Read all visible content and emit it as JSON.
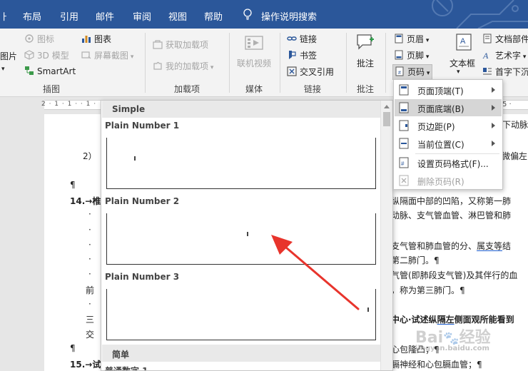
{
  "menubar": {
    "tabs": [
      "ㅏ",
      "布局",
      "引用",
      "邮件",
      "审阅",
      "视图",
      "帮助",
      "操作说明搜索"
    ]
  },
  "ribbon": {
    "illustrations": {
      "partial_left": "图片",
      "icons": "图标",
      "models_3d": "3D 模型",
      "smartart": "SmartArt",
      "chart": "图表",
      "screenshot": "屏幕截图",
      "group_label": "插图"
    },
    "addins": {
      "get_addins": "获取加载项",
      "my_addins": "我的加载项",
      "group_label": "加载项"
    },
    "media": {
      "online_video": "联机视频",
      "group_label": "媒体"
    },
    "links": {
      "link": "链接",
      "bookmark": "书签",
      "cross_ref": "交叉引用",
      "group_label": "链接"
    },
    "comments": {
      "comment": "批注",
      "group_label": "批注"
    },
    "header_footer": {
      "header": "页眉",
      "footer": "页脚",
      "page_number": "页码"
    },
    "text": {
      "textbox": "文本框",
      "quick_parts": "文档部件",
      "wordart": "艺术字",
      "dropcap": "首字下沉"
    }
  },
  "ruler": {
    "marks": "2 · 1 · 1 · · 1 ·",
    "right": "5 ·"
  },
  "gallery": {
    "section_simple": "Simple",
    "items": [
      "Plain Number 1",
      "Plain Number 2",
      "Plain Number 3"
    ],
    "section_cn": "简单",
    "cn_item": "普通数字 1"
  },
  "submenu": {
    "items": [
      "页面顶端(T)",
      "页面底端(B)",
      "页边距(P)",
      "当前位置(C)",
      "设置页码格式(F)...",
      "删除页码(R)"
    ]
  },
  "document": {
    "lines": [
      "下动脉",
      "2）",
      "微偏左",
      "¶",
      "14.→椎",
      "纵隔面中部的凹陷，又称第一肺",
      "·",
      "动脉、支气管血管、淋巴管和肺",
      "·",
      "·",
      "支气管和肺血管的分、",
      "属支等",
      "结",
      "·",
      "第二肺门。¶",
      "·",
      "气管(即肺段支气管)及其伴行的血",
      "前",
      "，称为第三肺门。¶",
      "·",
      "中心·试述纵",
      "隔左",
      "侧面观所能看到",
      "三",
      "交",
      "¶",
      "心包隆凸；¶",
      "15.→试",
      "膈神经和心包膈血管；¶"
    ]
  },
  "watermark": {
    "text": "Bai",
    "text2": "经验",
    "sub": "jingyan.baidu.com"
  },
  "colors": {
    "titlebar": "#2b579a",
    "highlight": "#d6d6d6",
    "arrow": "#e8342c"
  }
}
